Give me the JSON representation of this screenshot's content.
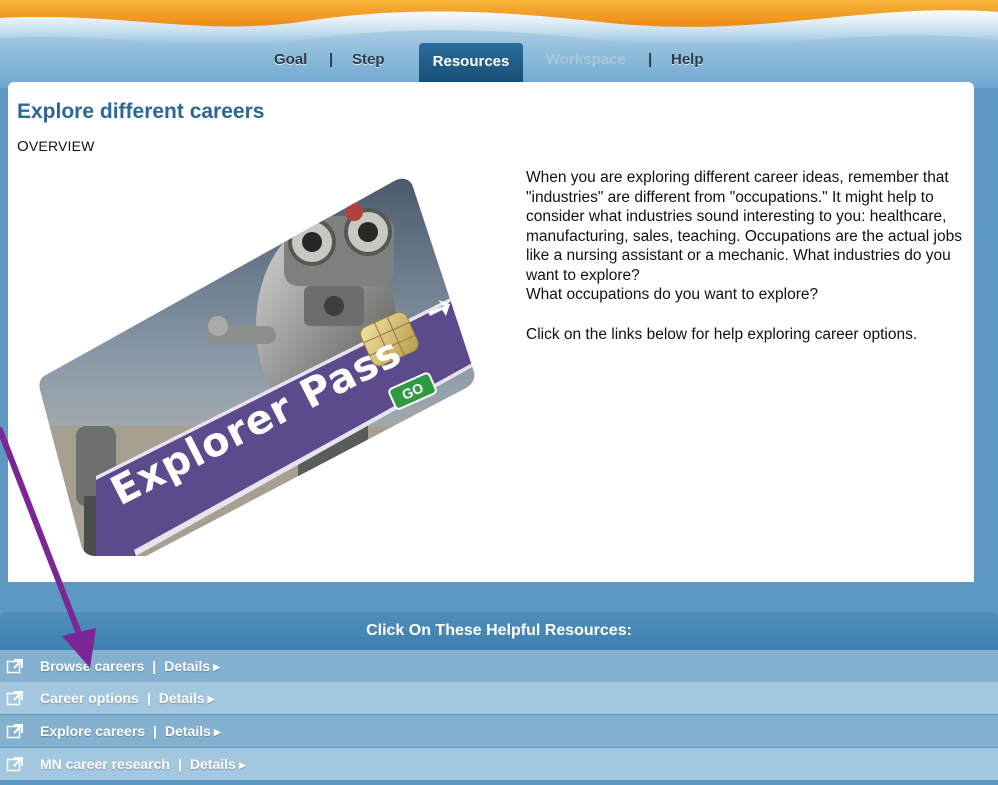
{
  "nav": {
    "tabs": [
      {
        "label": "Goal"
      },
      {
        "label": "Step"
      },
      {
        "label": "Resources",
        "active": true
      },
      {
        "label": "Workspace",
        "disabled": true
      },
      {
        "label": "Help"
      }
    ],
    "separator": "|"
  },
  "main": {
    "title": "Explore different careers",
    "section_label": "Overview",
    "intro_paragraphs": [
      "When you are exploring different career ideas, remember that \"industries\" are different from \"occupations.\" It might help to consider what industries sound interesting to you: healthcare, manufacturing, sales, teaching. Occupations are the actual jobs like a nursing assistant or a mechanic. What industries do you want to explore?",
      "What occupations do you want to explore?",
      "Click on the links below for help exploring career options."
    ],
    "card_image": {
      "brand_text": "Explorer Pass",
      "badge_text": "GO"
    }
  },
  "resources": {
    "heading": "Click On These Helpful Resources:",
    "items": [
      {
        "label": "Browse careers",
        "details": "Details"
      },
      {
        "label": "Career options",
        "details": "Details"
      },
      {
        "label": "Explore careers",
        "details": "Details"
      },
      {
        "label": "MN career research",
        "details": "Details"
      }
    ],
    "separator": "|"
  },
  "colors": {
    "title_blue": "#2b6893",
    "active_tab": "#1f5f8a",
    "annotation_arrow": "#7b2596",
    "header_orange": "#f5a623"
  }
}
